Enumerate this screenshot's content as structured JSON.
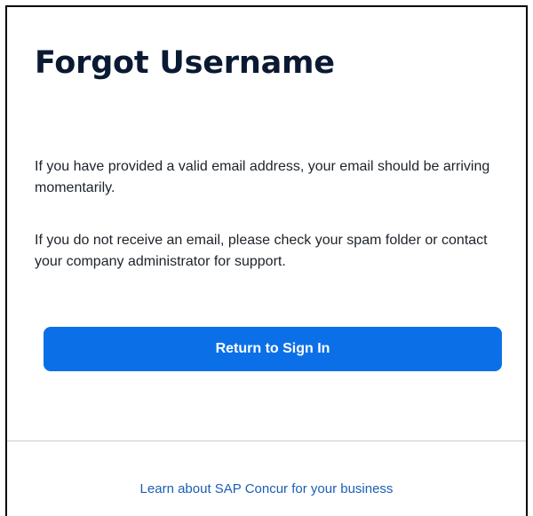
{
  "page": {
    "title": "Forgot Username",
    "message_1": "If you have provided a valid email address, your email should be arriving momentarily.",
    "message_2": "If you do not receive an email, please check your spam folder or contact your company administrator for support.",
    "return_button_label": "Return to Sign In"
  },
  "footer": {
    "link_text": "Learn about SAP Concur for your business"
  },
  "colors": {
    "primary_button": "#0b70e8",
    "link": "#1b5fb3",
    "title": "#0b1a33"
  }
}
